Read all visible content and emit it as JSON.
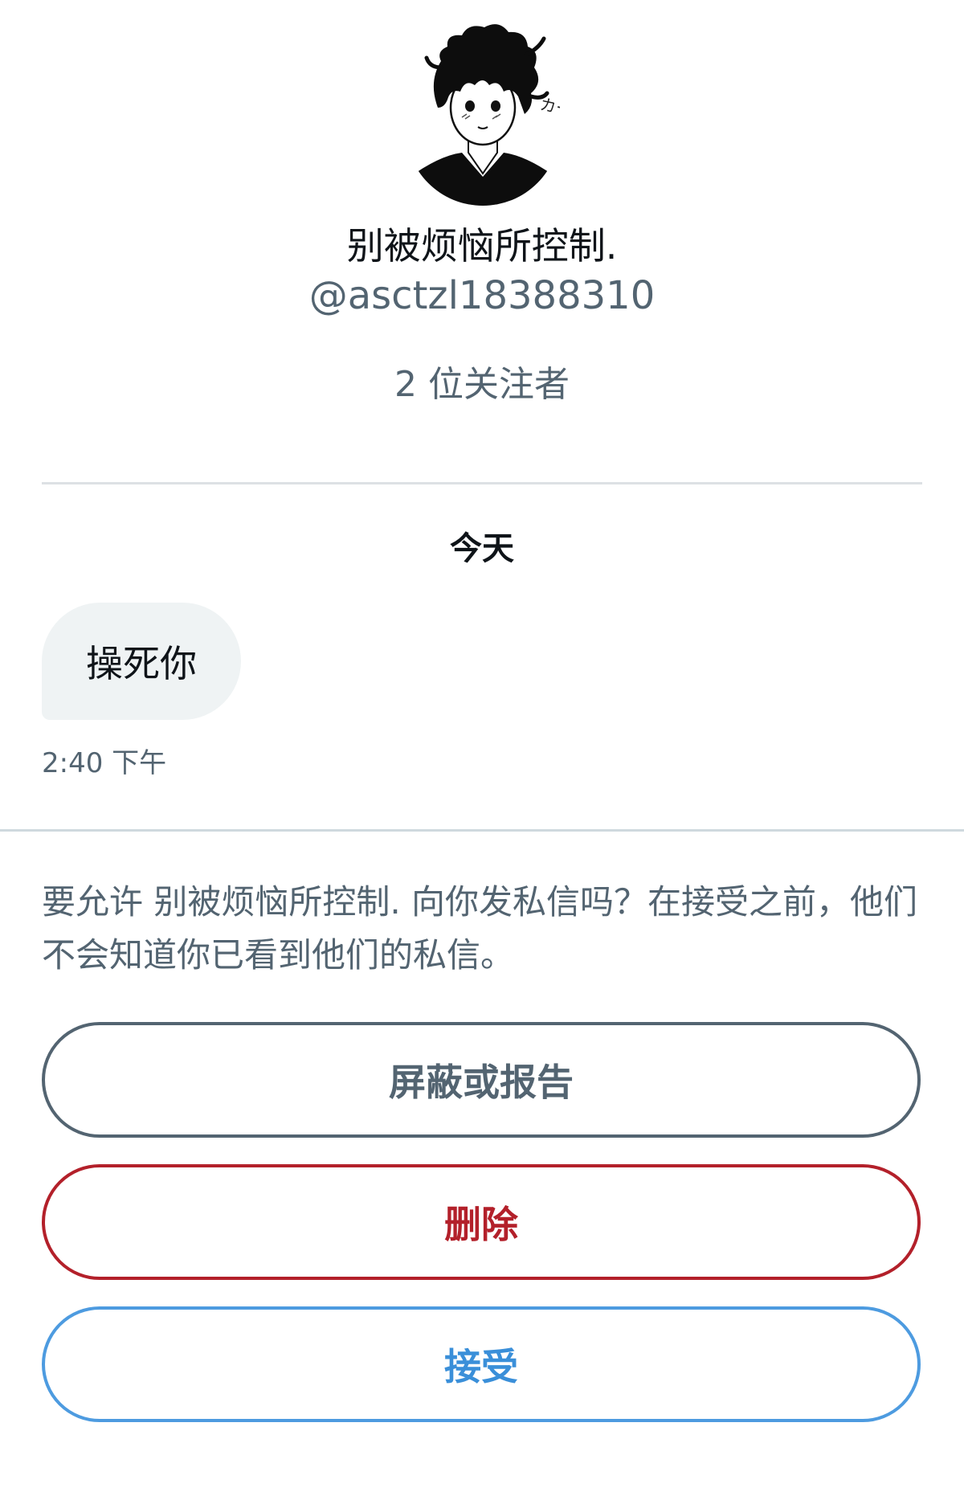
{
  "profile": {
    "display_name": "别被烦恼所控制.",
    "handle": "@asctzl18388310",
    "followers": "2 位关注者",
    "avatar_caption": "カーッ"
  },
  "conversation": {
    "day_label": "今天",
    "messages": [
      {
        "text": "操死你",
        "time": "2:40 下午"
      }
    ]
  },
  "request": {
    "prompt": "要允许 别被烦恼所控制. 向你发私信吗？在接受之前，他们不会知道你已看到他们的私信。"
  },
  "actions": {
    "block_report_label": "屏蔽或报告",
    "delete_label": "删除",
    "accept_label": "接受"
  },
  "colors": {
    "text_primary": "#0f1419",
    "text_secondary": "#536471",
    "bubble_bg": "#eff3f4",
    "delete_red": "#b3202a",
    "accept_blue": "#4d9be0"
  }
}
